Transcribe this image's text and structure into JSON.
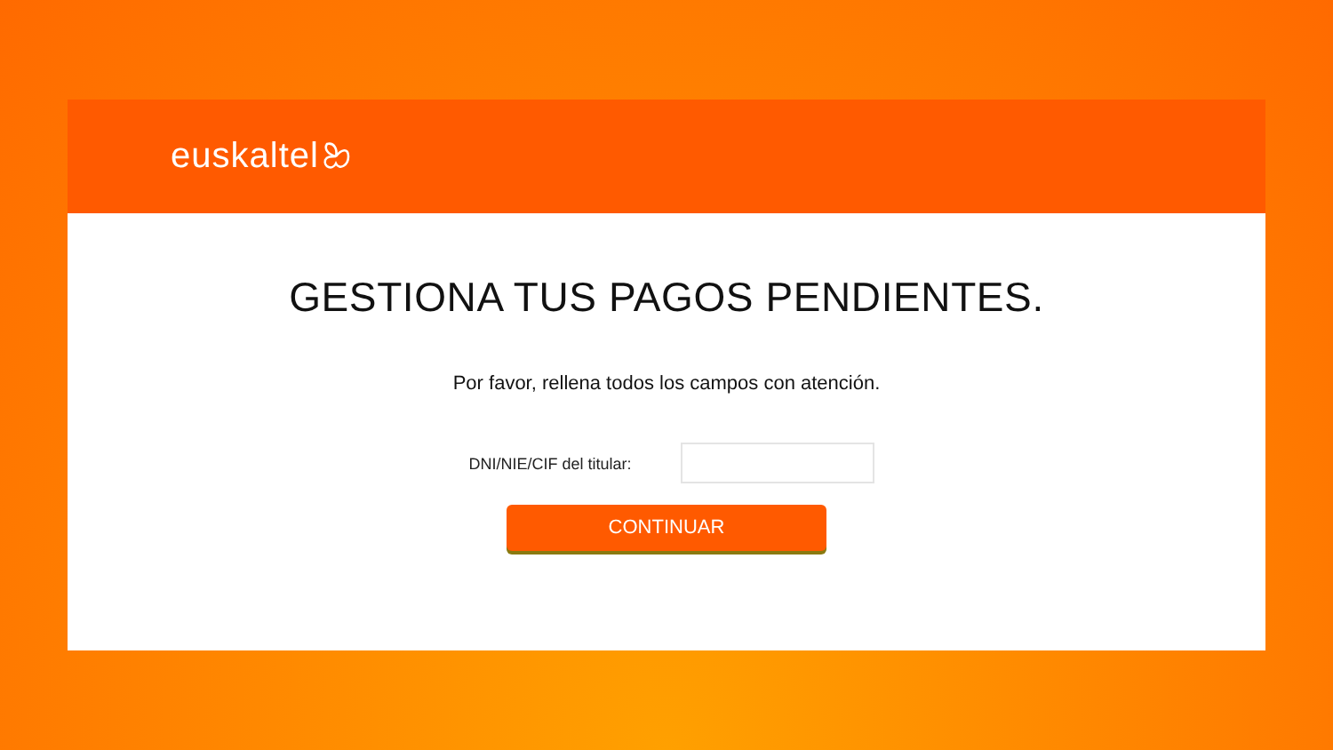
{
  "header": {
    "logo": "euskaltel"
  },
  "title": "GESTIONA TUS PAGOS PENDIENTES.",
  "instructions": "Por favor, rellena todos los campos con atención.",
  "field": {
    "label": "DNI/NIE/CIF del titular:"
  },
  "button": "CONTINUAR"
}
